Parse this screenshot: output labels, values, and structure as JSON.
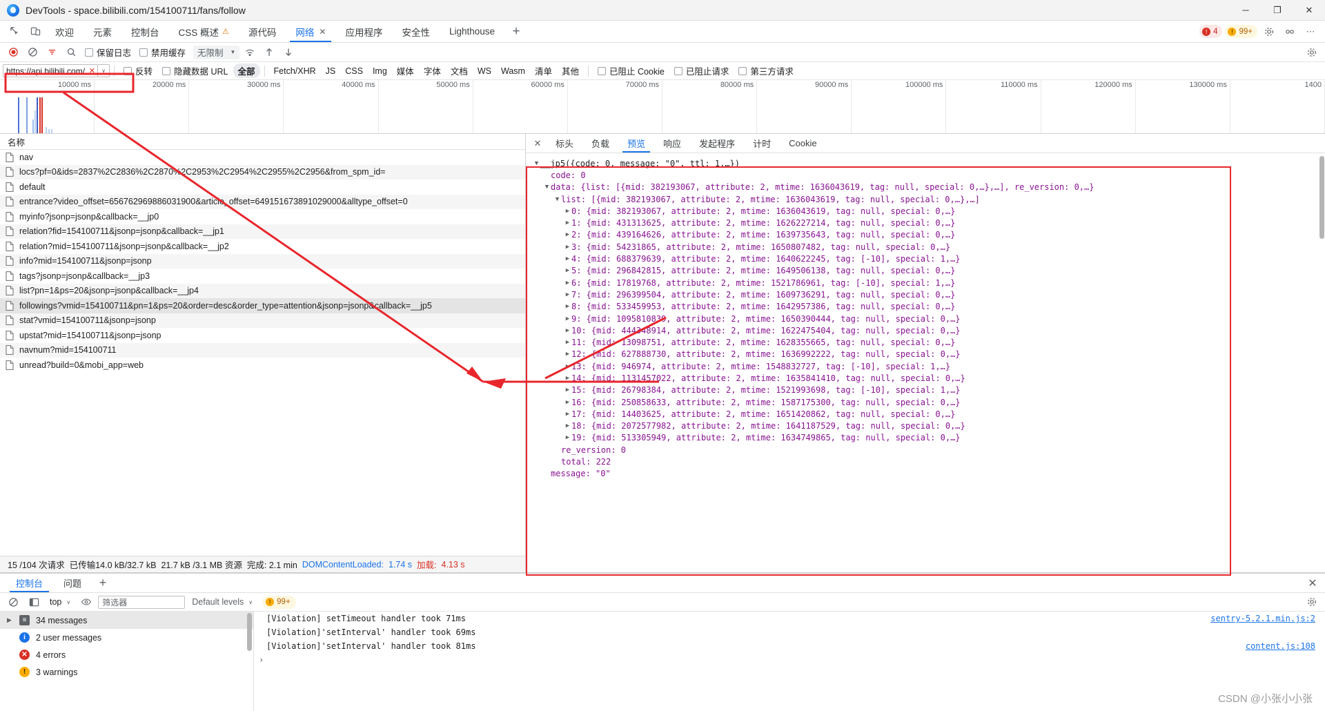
{
  "window": {
    "title": "DevTools - space.bilibili.com/154100711/fans/follow",
    "minimize": "─",
    "maximize": "❐",
    "close": "✕"
  },
  "devtools_tabs": {
    "items": [
      {
        "label": "欢迎",
        "active": false
      },
      {
        "label": "元素",
        "active": false
      },
      {
        "label": "控制台",
        "active": false
      },
      {
        "label": "CSS 概述",
        "active": false,
        "warn": "⚠"
      },
      {
        "label": "源代码",
        "active": false
      },
      {
        "label": "网络",
        "active": true,
        "closable": "✕"
      },
      {
        "label": "应用程序",
        "active": false
      },
      {
        "label": "安全性",
        "active": false
      },
      {
        "label": "Lighthouse",
        "active": false
      }
    ],
    "add_label": "+",
    "error_count": "4",
    "warning_count": "99+"
  },
  "network_toolbar": {
    "record_title": "record",
    "clear_title": "clear",
    "filter_title": "filter",
    "search_title": "search",
    "preserve_log": "保留日志",
    "disable_cache": "禁用缓存",
    "throttling": "无限制",
    "caret": "▼"
  },
  "filter_row": {
    "filter_value": "https://api.bilibili.com/",
    "clear_glyph": "✕",
    "dropdown_caret": "∨",
    "invert": "反转",
    "hide_data_urls": "隐藏数据 URL",
    "types": [
      {
        "label": "全部",
        "active": true
      },
      {
        "label": "Fetch/XHR",
        "active": false
      },
      {
        "label": "JS",
        "active": false
      },
      {
        "label": "CSS",
        "active": false
      },
      {
        "label": "Img",
        "active": false
      },
      {
        "label": "媒体",
        "active": false
      },
      {
        "label": "字体",
        "active": false
      },
      {
        "label": "文档",
        "active": false
      },
      {
        "label": "WS",
        "active": false
      },
      {
        "label": "Wasm",
        "active": false
      },
      {
        "label": "清单",
        "active": false
      },
      {
        "label": "其他",
        "active": false
      }
    ],
    "blocked_cookies": "已阻止 Cookie",
    "blocked_requests": "已阻止请求",
    "third_party": "第三方请求"
  },
  "overview": {
    "ticks": [
      "10000 ms",
      "20000 ms",
      "30000 ms",
      "40000 ms",
      "50000 ms",
      "60000 ms",
      "70000 ms",
      "80000 ms",
      "90000 ms",
      "100000 ms",
      "110000 ms",
      "120000 ms",
      "130000 ms",
      "1400"
    ]
  },
  "requests": {
    "header": "名称",
    "rows": [
      {
        "name": "nav",
        "selected": false
      },
      {
        "name": "locs?pf=0&ids=2837%2C2836%2C2870%2C2953%2C2954%2C2955%2C2956&from_spm_id=",
        "selected": false
      },
      {
        "name": "default",
        "selected": false
      },
      {
        "name": "entrance?video_offset=656762969886031900&article_offset=649151673891029000&alltype_offset=0",
        "selected": false
      },
      {
        "name": "myinfo?jsonp=jsonp&callback=__jp0",
        "selected": false
      },
      {
        "name": "relation?fid=154100711&jsonp=jsonp&callback=__jp1",
        "selected": false
      },
      {
        "name": "relation?mid=154100711&jsonp=jsonp&callback=__jp2",
        "selected": false
      },
      {
        "name": "info?mid=154100711&jsonp=jsonp",
        "selected": false
      },
      {
        "name": "tags?jsonp=jsonp&callback=__jp3",
        "selected": false
      },
      {
        "name": "list?pn=1&ps=20&jsonp=jsonp&callback=__jp4",
        "selected": false
      },
      {
        "name": "followings?vmid=154100711&pn=1&ps=20&order=desc&order_type=attention&jsonp=jsonp&callback=__jp5",
        "selected": true
      },
      {
        "name": "stat?vmid=154100711&jsonp=jsonp",
        "selected": false
      },
      {
        "name": "upstat?mid=154100711&jsonp=jsonp",
        "selected": false
      },
      {
        "name": "navnum?mid=154100711",
        "selected": false
      },
      {
        "name": "unread?build=0&mobi_app=web",
        "selected": false
      }
    ],
    "status": {
      "requests": "15 /104 次请求",
      "transferred": "已传输14.0 kB/32.7 kB",
      "resources": "21.7 kB /3.1 MB 资源",
      "finish": "完成: 2.1 min",
      "dcl_label": "DOMContentLoaded:",
      "dcl_value": "1.74 s",
      "load_label": "加载:",
      "load_value": "4.13 s"
    }
  },
  "detail": {
    "close_glyph": "✕",
    "tabs": [
      {
        "label": "标头",
        "active": false
      },
      {
        "label": "负载",
        "active": false
      },
      {
        "label": "预览",
        "active": true
      },
      {
        "label": "响应",
        "active": false
      },
      {
        "label": "发起程序",
        "active": false
      },
      {
        "label": "计时",
        "active": false
      },
      {
        "label": "Cookie",
        "active": false
      }
    ],
    "preview_rows": [
      {
        "indent": 0,
        "arrow": "▼",
        "text": "__jp5({code: 0, message: \"0\", ttl: 1,…})",
        "kind": "plain"
      },
      {
        "indent": 1,
        "arrow": "",
        "text": "code: 0",
        "kind": "prop"
      },
      {
        "indent": 1,
        "arrow": "▼",
        "text": "data: {list: [{mid: 382193067, attribute: 2, mtime: 1636043619, tag: null, special: 0,…},…], re_version: 0,…}",
        "kind": "prop"
      },
      {
        "indent": 2,
        "arrow": "▼",
        "text": "list: [{mid: 382193067, attribute: 2, mtime: 1636043619, tag: null, special: 0,…},…]",
        "kind": "prop"
      },
      {
        "indent": 3,
        "arrow": "▶",
        "text": "0: {mid: 382193067, attribute: 2, mtime: 1636043619, tag: null, special: 0,…}",
        "kind": "prop"
      },
      {
        "indent": 3,
        "arrow": "▶",
        "text": "1: {mid: 431313625, attribute: 2, mtime: 1626227214, tag: null, special: 0,…}",
        "kind": "prop"
      },
      {
        "indent": 3,
        "arrow": "▶",
        "text": "2: {mid: 439164626, attribute: 2, mtime: 1639735643, tag: null, special: 0,…}",
        "kind": "prop"
      },
      {
        "indent": 3,
        "arrow": "▶",
        "text": "3: {mid: 54231865, attribute: 2, mtime: 1650807482, tag: null, special: 0,…}",
        "kind": "prop"
      },
      {
        "indent": 3,
        "arrow": "▶",
        "text": "4: {mid: 688379639, attribute: 2, mtime: 1640622245, tag: [-10], special: 1,…}",
        "kind": "prop"
      },
      {
        "indent": 3,
        "arrow": "▶",
        "text": "5: {mid: 296842815, attribute: 2, mtime: 1649506138, tag: null, special: 0,…}",
        "kind": "prop"
      },
      {
        "indent": 3,
        "arrow": "▶",
        "text": "6: {mid: 17819768, attribute: 2, mtime: 1521786961, tag: [-10], special: 1,…}",
        "kind": "prop"
      },
      {
        "indent": 3,
        "arrow": "▶",
        "text": "7: {mid: 296399504, attribute: 2, mtime: 1609736291, tag: null, special: 0,…}",
        "kind": "prop"
      },
      {
        "indent": 3,
        "arrow": "▶",
        "text": "8: {mid: 533459953, attribute: 2, mtime: 1642957386, tag: null, special: 0,…}",
        "kind": "prop"
      },
      {
        "indent": 3,
        "arrow": "▶",
        "text": "9: {mid: 1095810839, attribute: 2, mtime: 1650390444, tag: null, special: 0,…}",
        "kind": "prop"
      },
      {
        "indent": 3,
        "arrow": "▶",
        "text": "10: {mid: 444348914, attribute: 2, mtime: 1622475404, tag: null, special: 0,…}",
        "kind": "prop"
      },
      {
        "indent": 3,
        "arrow": "▶",
        "text": "11: {mid: 13098751, attribute: 2, mtime: 1628355665, tag: null, special: 0,…}",
        "kind": "prop"
      },
      {
        "indent": 3,
        "arrow": "▶",
        "text": "12: {mid: 627888730, attribute: 2, mtime: 1636992222, tag: null, special: 0,…}",
        "kind": "prop"
      },
      {
        "indent": 3,
        "arrow": "▶",
        "text": "13: {mid: 946974, attribute: 2, mtime: 1548832727, tag: [-10], special: 1,…}",
        "kind": "prop"
      },
      {
        "indent": 3,
        "arrow": "▶",
        "text": "14: {mid: 1131457022, attribute: 2, mtime: 1635841410, tag: null, special: 0,…}",
        "kind": "prop"
      },
      {
        "indent": 3,
        "arrow": "▶",
        "text": "15: {mid: 26798384, attribute: 2, mtime: 1521993698, tag: [-10], special: 1,…}",
        "kind": "prop"
      },
      {
        "indent": 3,
        "arrow": "▶",
        "text": "16: {mid: 250858633, attribute: 2, mtime: 1587175300, tag: null, special: 0,…}",
        "kind": "prop"
      },
      {
        "indent": 3,
        "arrow": "▶",
        "text": "17: {mid: 14403625, attribute: 2, mtime: 1651420862, tag: null, special: 0,…}",
        "kind": "prop"
      },
      {
        "indent": 3,
        "arrow": "▶",
        "text": "18: {mid: 2072577982, attribute: 2, mtime: 1641187529, tag: null, special: 0,…}",
        "kind": "prop"
      },
      {
        "indent": 3,
        "arrow": "▶",
        "text": "19: {mid: 513305949, attribute: 2, mtime: 1634749865, tag: null, special: 0,…}",
        "kind": "prop"
      },
      {
        "indent": 2,
        "arrow": "",
        "text": "re_version: 0",
        "kind": "prop"
      },
      {
        "indent": 2,
        "arrow": "",
        "text": "total: 222",
        "kind": "prop"
      },
      {
        "indent": 1,
        "arrow": "",
        "text": "message: \"0\"",
        "kind": "prop"
      }
    ]
  },
  "drawer": {
    "tabs": [
      {
        "label": "控制台",
        "active": true
      },
      {
        "label": "问题",
        "active": false
      }
    ],
    "add_label": "+",
    "close_glyph": "✕",
    "context": "top",
    "context_caret": "∨",
    "filter_placeholder": "筛选器",
    "levels": "Default levels",
    "levels_caret": "∨",
    "warning_badge": "99+",
    "sidebar": [
      {
        "label": "34 messages",
        "icon": "list-icon",
        "selected": true,
        "tri": "▶"
      },
      {
        "label": "2 user messages",
        "icon": "info-icon",
        "selected": false,
        "tri": ""
      },
      {
        "label": "4 errors",
        "icon": "error-icon",
        "selected": false,
        "tri": ""
      },
      {
        "label": "3 warnings",
        "icon": "warning-icon",
        "selected": false,
        "tri": ""
      }
    ],
    "logs": [
      {
        "text": "[Violation] setTimeout  handler took 71ms",
        "source": "sentry-5.2.1.min.js:2"
      },
      {
        "text": "[Violation]'setInterval' handler took 69ms",
        "source": ""
      },
      {
        "text": "[Violation]'setInterval' handler took 81ms",
        "source": "content.js:108"
      }
    ],
    "prompt": "›"
  },
  "watermark": "CSDN @小张小小张",
  "colors": {
    "accent": "#1a73e8",
    "error": "#d93025",
    "warning": "#f9ab00",
    "annotation": "#e8262c"
  }
}
